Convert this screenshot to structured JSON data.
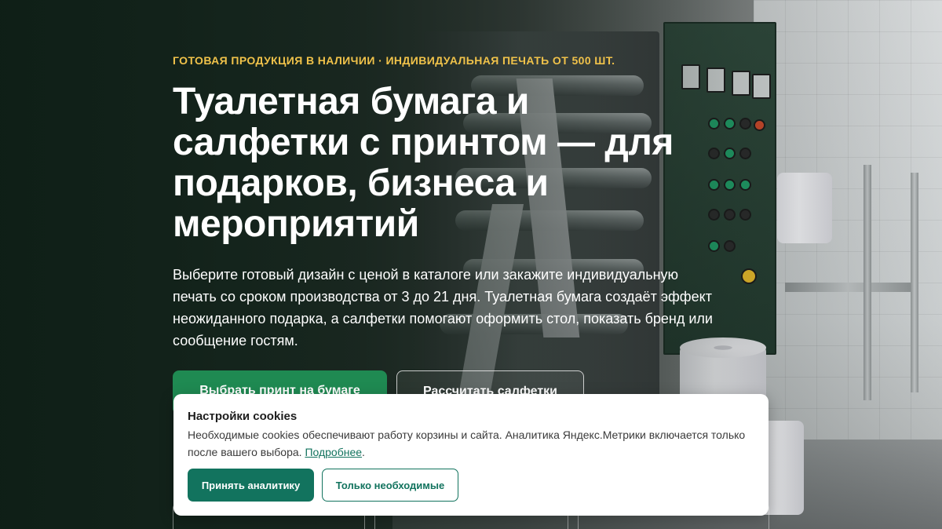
{
  "hero": {
    "eyebrow": "ГОТОВАЯ ПРОДУКЦИЯ В НАЛИЧИИ · ИНДИВИДУАЛЬНАЯ ПЕЧАТЬ ОТ 500 ШТ.",
    "title": "Туалетная бумага и салфетки с принтом — для подарков, бизнеса и мероприятий",
    "lead": "Выберите готовый дизайн с ценой в каталоге или закажите индивидуальную печать со сроком производства от 3 до 21 дня. Туалетная бумага создаёт эффект неожиданного подарка, а салфетки помогают оформить стол, показать бренд или сообщение гостям.",
    "primary_button": "Выбрать принт на бумаге",
    "secondary_button": "Рассчитать салфетки"
  },
  "cookie": {
    "title": "Настройки cookies",
    "text": "Необходимые cookies обеспечивают работу корзины и сайта. Аналитика Яндекс.Метрики включается только после вашего выбора.",
    "link": "Подробнее",
    "text_end": ".",
    "accept_button": "Принять аналитику",
    "necessary_button": "Только необходимые"
  },
  "colors": {
    "eyebrow": "#f0c24a",
    "primary": "#1f8a52",
    "cookie_accent": "#12735e"
  }
}
